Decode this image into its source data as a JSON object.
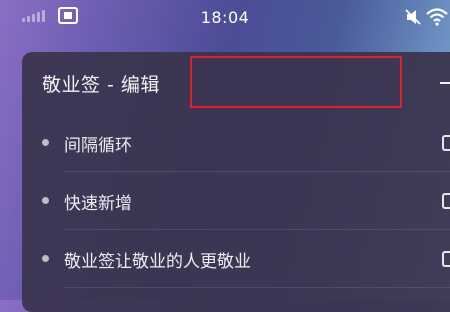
{
  "status_bar": {
    "time": "18:04",
    "icons": [
      "signal-icon",
      "sim-card-icon",
      "mute-icon",
      "wifi-icon"
    ]
  },
  "card": {
    "title": "敬业签 - 编辑",
    "items": [
      {
        "label": "间隔循环"
      },
      {
        "label": "快速新增"
      },
      {
        "label": "敬业签让敬业的人更敬业"
      }
    ]
  },
  "colors": {
    "highlight": "#e0202a",
    "card_bg": "#3a344e"
  }
}
